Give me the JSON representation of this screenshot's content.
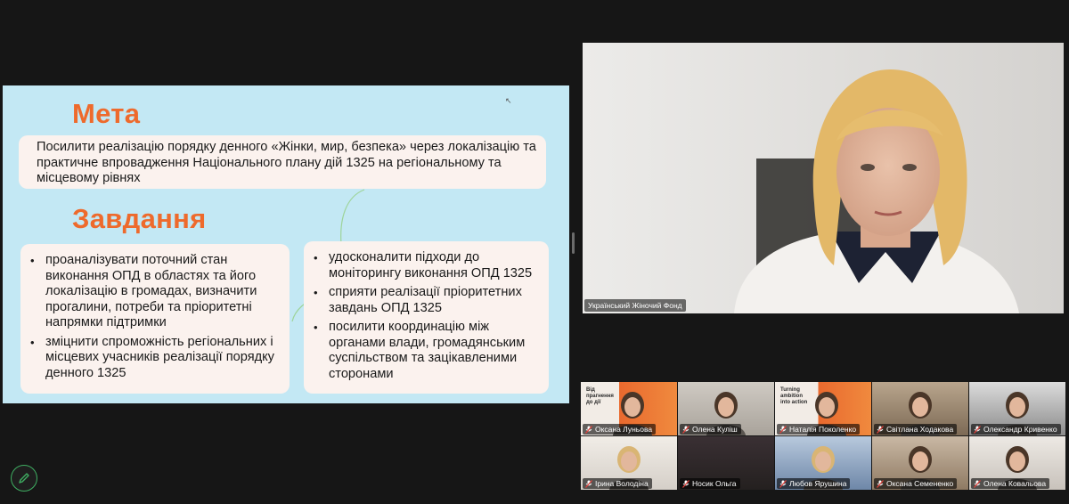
{
  "slide": {
    "goal_heading": "Мета",
    "goal_text": "Посилити реалізацію порядку денного «Жінки, мир, безпека» через локалізацію та практичне впровадження Національного плану дій 1325 на регіональному та місцевому рівнях",
    "tasks_heading": "Завдання",
    "tasks_left": [
      "проаналізувати поточний стан виконання ОПД в областях та його локалізацію в громадах,  визначити прогалини, потреби та пріоритетні напрямки підтримки",
      "зміцнити спроможність регіональних і місцевих учасників реалізації порядку денного 1325"
    ],
    "tasks_right": [
      "удосконалити підходи до моніторингу виконання ОПД 1325",
      "сприяти реалізації пріоритетних завдань ОПД 1325",
      "посилити координацію між органами влади, громадянським суспільством та зацікавленими сторонами"
    ],
    "accent_color": "#ee6a2c",
    "background_color": "#c3e8f4"
  },
  "speaker": {
    "name": "Український Жіночий Фонд"
  },
  "participants": [
    {
      "name": "Оксана Луньова",
      "muted": true
    },
    {
      "name": "Олена Куліш",
      "muted": true
    },
    {
      "name": "Наталія Поколенко",
      "muted": true
    },
    {
      "name": "Світлана Ходакова",
      "muted": true
    },
    {
      "name": "Олександр Кривенко",
      "muted": true
    },
    {
      "name": "Ірина Володіна",
      "muted": true
    },
    {
      "name": "Носик Ольга",
      "muted": true
    },
    {
      "name": "Любов Ярушина",
      "muted": true
    },
    {
      "name": "Оксана Семененко",
      "muted": true
    },
    {
      "name": "Олена Ковальова",
      "muted": true
    }
  ],
  "promo": {
    "tile1": "Від прагнення до дії",
    "tile3": "Turning ambition into action"
  },
  "icons": {
    "annotate": "pencil-icon",
    "mic": "mic-off-icon"
  }
}
